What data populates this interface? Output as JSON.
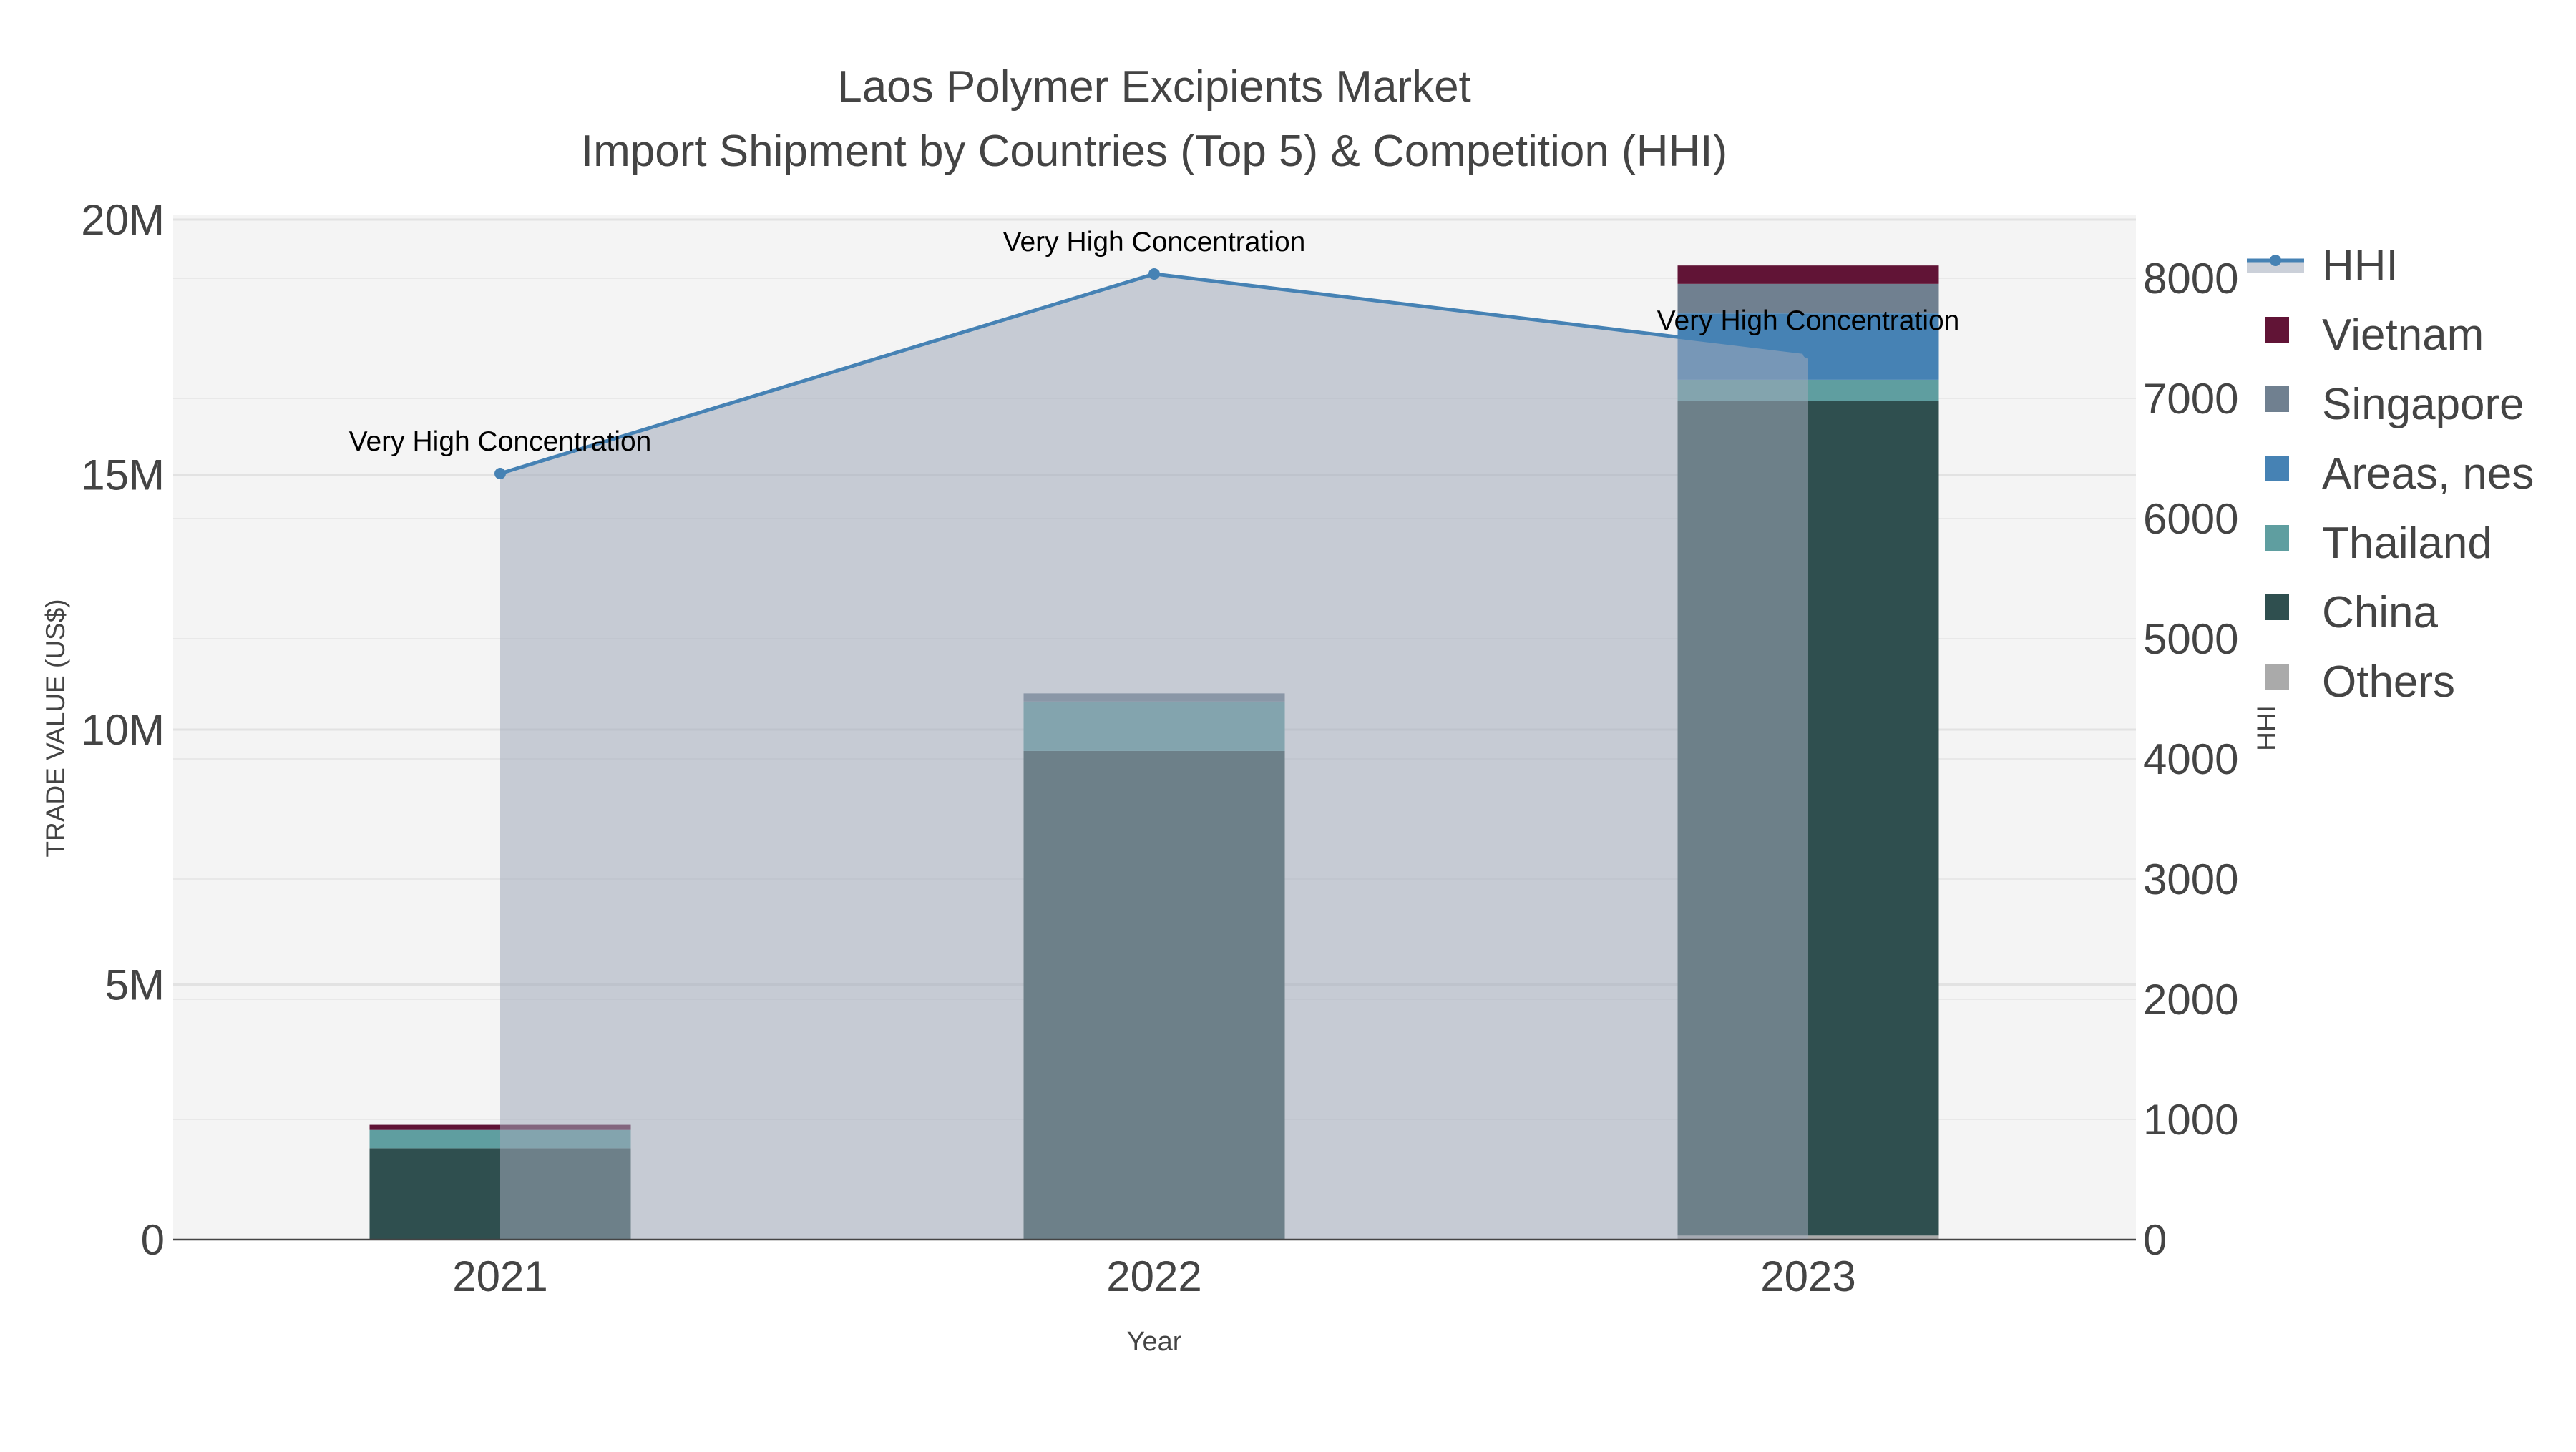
{
  "chart_data": {
    "type": "bar",
    "title": "Laos Polymer Excipients Market",
    "subtitle": "Import Shipment by Countries (Top 5) & Competition (HHI)",
    "xlabel": "Year",
    "ylabel": "TRADE VALUE (US$)",
    "y2label": "HHI",
    "categories": [
      "2021",
      "2022",
      "2023"
    ],
    "ylim": [
      0,
      20000000
    ],
    "y_ticks": [
      0,
      5000000,
      10000000,
      15000000,
      20000000
    ],
    "y_tick_labels": [
      "0",
      "5M",
      "10M",
      "15M",
      "20M"
    ],
    "y2lim": [
      0,
      8500
    ],
    "y2_ticks": [
      0,
      1000,
      2000,
      3000,
      4000,
      5000,
      6000,
      7000,
      8000
    ],
    "y2_tick_labels": [
      "0",
      "1000",
      "2000",
      "3000",
      "4000",
      "5000",
      "6000",
      "7000",
      "8000"
    ],
    "grid": true,
    "legend_position": "right",
    "stack_order": [
      "Others",
      "China",
      "Thailand",
      "Areas, nes",
      "Singapore",
      "Vietnam"
    ],
    "series": [
      {
        "name": "Others",
        "color": "#aaaaaa",
        "values": [
          0,
          0,
          80000
        ]
      },
      {
        "name": "China",
        "color": "#2f4f4f",
        "values": [
          1790000,
          9580000,
          16360000
        ]
      },
      {
        "name": "Thailand",
        "color": "#5f9ea0",
        "values": [
          360000,
          970000,
          420000
        ]
      },
      {
        "name": "Areas, nes",
        "color": "#4682b4",
        "values": [
          0,
          0,
          1300000
        ]
      },
      {
        "name": "Singapore",
        "color": "#708090",
        "values": [
          0,
          160000,
          580000
        ]
      },
      {
        "name": "Vietnam",
        "color": "#611436",
        "values": [
          100000,
          0,
          360000
        ]
      }
    ],
    "hhi": {
      "name": "HHI",
      "color": "#4682b4",
      "values": [
        6375,
        8036,
        7380
      ],
      "annotations": [
        "Very High Concentration",
        "Very High Concentration",
        "Very High Concentration"
      ]
    },
    "legend": [
      "HHI",
      "Vietnam",
      "Singapore",
      "Areas, nes",
      "Thailand",
      "China",
      "Others"
    ]
  }
}
